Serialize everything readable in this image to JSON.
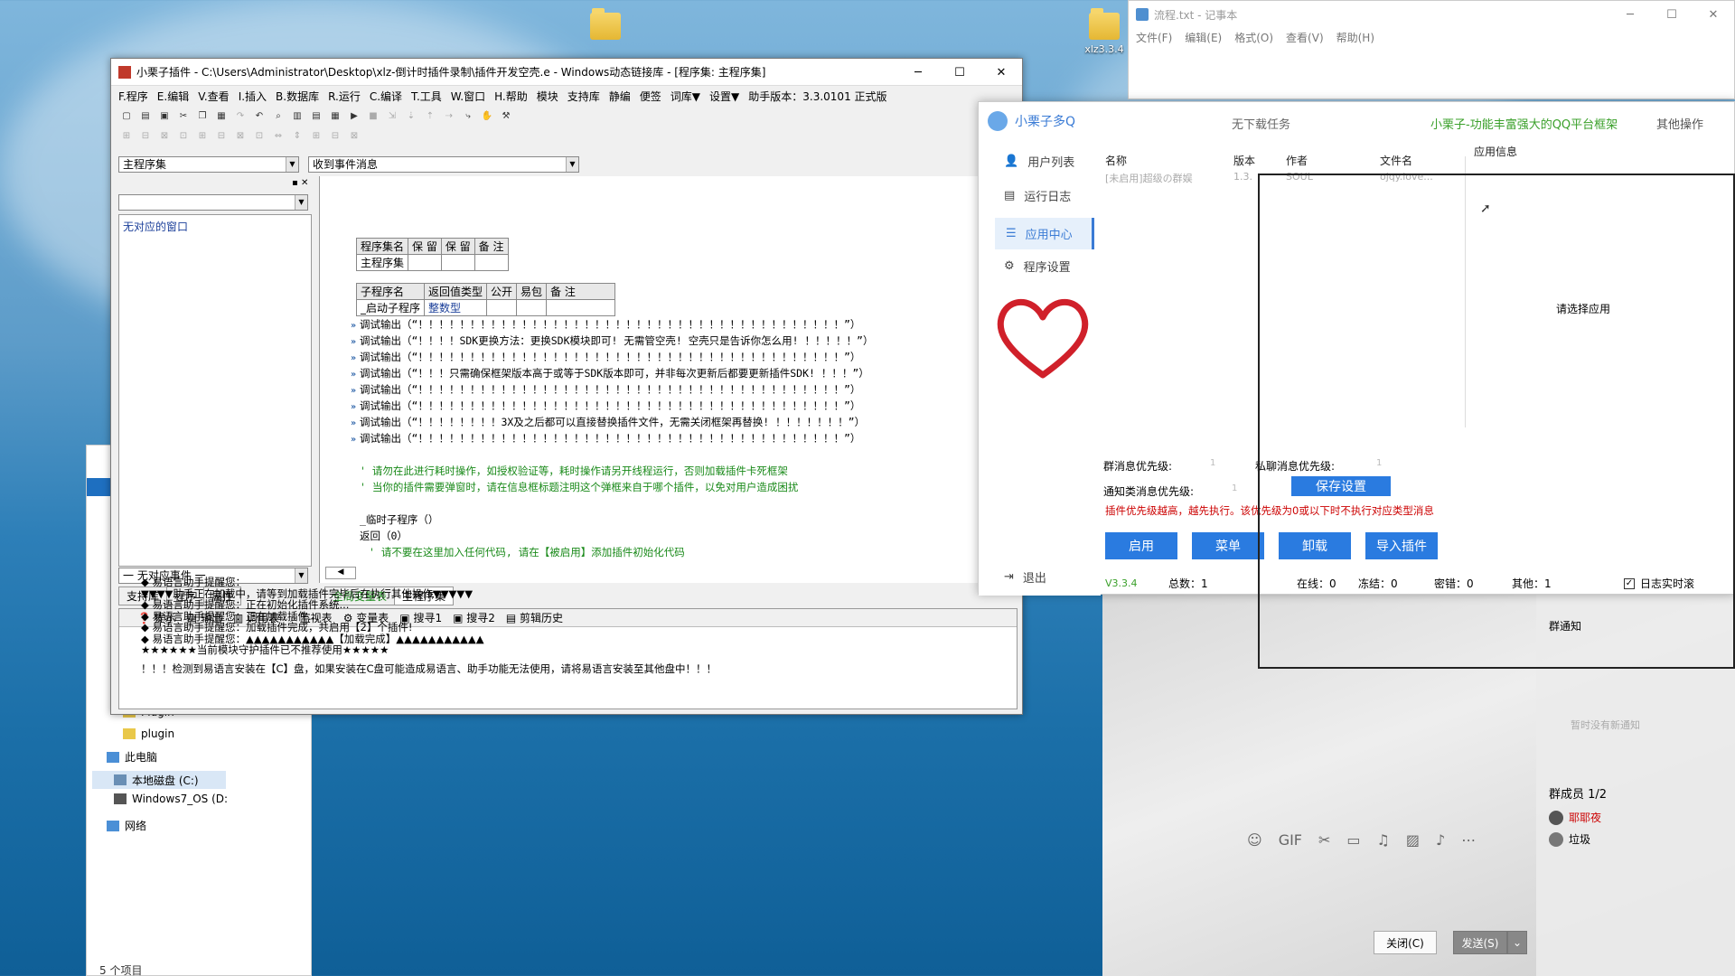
{
  "desktop": {
    "icon_label": "xlz3.3.4"
  },
  "notepad": {
    "title": "流程.txt - 记事本",
    "menu": [
      "文件(F)",
      "编辑(E)",
      "格式(O)",
      "查看(V)",
      "帮助(H)"
    ]
  },
  "ide": {
    "title": "小栗子插件 - C:\\Users\\Administrator\\Desktop\\xlz-倒计时插件录制\\插件开发空壳.e - Windows动态链接库 - [程序集: 主程序集]",
    "menu": [
      "F.程序",
      "E.编辑",
      "V.查看",
      "I.插入",
      "B.数据库",
      "R.运行",
      "C.编译",
      "T.工具",
      "W.窗口",
      "H.帮助",
      "模块",
      "支持库",
      "静编",
      "便签",
      "词库▼",
      "设置▼",
      "助手版本：3.3.0101 正式版"
    ],
    "combo_left": "主程序集",
    "combo_right": "收到事件消息",
    "left_combo": "",
    "no_window": "无对应的窗口",
    "no_event": "一 无对应事件 一",
    "left_tabs": [
      "支持库",
      "程序",
      "属性"
    ],
    "table1_headers": [
      "程序集名",
      "保 留",
      "保 留",
      "备 注"
    ],
    "table1_row": [
      "主程序集",
      "",
      "",
      ""
    ],
    "table2_headers": [
      "子程序名",
      "返回值类型",
      "公开",
      "易包",
      "备 注"
    ],
    "table2_row": [
      "_启动子程序",
      "整数型",
      "",
      "",
      ""
    ],
    "code_lines": [
      "调试输出（“！！！！！！！！！！！！！！！！！！！！！！！！！！！！！！！！！！！！！！！！！”）",
      "调试输出（“！！！！SDK更换方法：更换SDK模块即可! 无需管空壳! 空壳只是告诉你怎么用! ！！！！！”）",
      "调试输出（“！！！！！！！！！！！！！！！！！！！！！！！！！！！！！！！！！！！！！！！！！”）",
      "调试输出（“！！！只需确保框架版本高于或等于SDK版本即可，并非每次更新后都要更新插件SDK! ！！！”）",
      "调试输出（“！！！！！！！！！！！！！！！！！！！！！！！！！！！！！！！！！！！！！！！！！”）",
      "调试输出（“！！！！！！！！！！！！！！！！！！！！！！！！！！！！！！！！！！！！！！！！！”）",
      "调试输出（“！！！！！！！！3X及之后都可以直接替换插件文件，无需关闭框架再替换! ！！！！！！！”）",
      "调试输出（“！！！！！！！！！！！！！！！！！！！！！！！！！！！！！！！！！！！！！！！！！”）"
    ],
    "comment1": "' 请勿在此进行耗时操作，如授权验证等，耗时操作请另开线程运行，否则加载插件卡死框架",
    "comment2": "' 当你的插件需要弹窗时，请在信息框标题注明这个弹框来自于哪个插件，以免对用户造成困扰",
    "sub_temp": "_临时子程序（）",
    "return_line": "返回（0）",
    "comment3": "' 请不要在这里加入任何代码, 请在【被启用】添加插件初始化代码",
    "code_tabs": [
      "全局变量表",
      "主程序集"
    ],
    "out_tabs": [
      "提示",
      "输出",
      "调用表",
      "监视表",
      "变量表",
      "搜寻1",
      "搜寻2",
      "剪辑历史"
    ],
    "out_lines": [
      "◆ 易语言助手提醒您：",
      "▼▼▼▼助手正在加载中，请等到加载插件完毕后在执行其他操作▼▼▼▼▼",
      "◆ 易语言助手提醒您：正在初始化插件系统...",
      "◆ 易语言助手提醒您：正在加载插件...",
      "◆ 易语言助手提醒您：加载插件完成，共启用【2】个插件!",
      "◆ 易语言助手提醒您：▲▲▲▲▲▲▲▲▲▲▲【加载完成】▲▲▲▲▲▲▲▲▲▲▲",
      "★★★★★★当前模块守护插件已不推荐使用★★★★★",
      "",
      "！！！检测到易语言安装在【C】盘，如果安装在C盘可能造成易语言、助手功能无法使用，请将易语言安装至其他盘中！！！"
    ]
  },
  "explorer": {
    "items": [
      "Plugin",
      "plugin",
      "此电脑",
      "本地磁盘 (C:)",
      "Windows7_OS (D:",
      "网络"
    ],
    "status": "5 个项目"
  },
  "plugin": {
    "app_name": "小栗子多Q",
    "no_download": "无下载任务",
    "slogan": "小栗子-功能丰富强大的QQ平台框架",
    "other_ops": "其他操作",
    "nav": [
      "用户列表",
      "运行日志",
      "应用中心",
      "程序设置"
    ],
    "logout": "退出",
    "col_headers": [
      "名称",
      "版本",
      "作者",
      "文件名"
    ],
    "row": [
      "[未启用]超级の群娱",
      "1.3.",
      "SOUL",
      "ojqy.love..."
    ],
    "app_info": "应用信息",
    "select_app": "请选择应用",
    "group_priority": "群消息优先级:",
    "private_priority": "私聊消息优先级:",
    "notify_priority": "通知类消息优先级:",
    "group_priority_val": "1",
    "private_priority_val": "1",
    "notify_priority_val": "1",
    "save_settings": "保存设置",
    "warning": "插件优先级越高，越先执行。该优先级为0或以下时不执行对应类型消息",
    "buttons": [
      "启用",
      "菜单",
      "卸载",
      "导入插件"
    ],
    "version": "V3.3.4",
    "total": "总数：1",
    "online": "在线：0",
    "frozen": "冻结：0",
    "pwd_err": "密错：0",
    "other": "其他：1",
    "log_realtime": "日志实时滚"
  },
  "qq": {
    "group_notice": "群通知",
    "no_notice": "暂时没有新通知",
    "members": "群成员 1/2",
    "member1": "耶耶夜",
    "member2": "垃圾",
    "close_btn": "关闭(C)",
    "send_btn": "发送(S)"
  },
  "colors": {
    "accent": "#2a7be0",
    "warning": "#cc0000",
    "comment": "#1a8a1a",
    "slogan": "#3aa02a"
  }
}
